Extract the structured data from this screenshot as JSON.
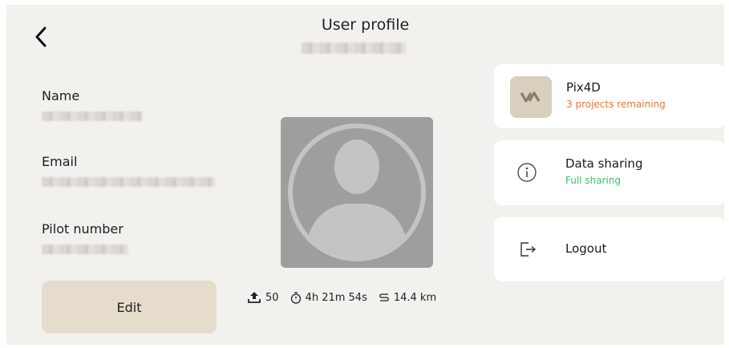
{
  "header": {
    "back_icon": "chevron-left-icon",
    "title": "User profile"
  },
  "profile": {
    "name_label": "Name",
    "email_label": "Email",
    "pilot_number_label": "Pilot number",
    "edit_label": "Edit"
  },
  "stats": {
    "uploads_icon": "upload-icon",
    "uploads": "50",
    "flight_time_icon": "stopwatch-icon",
    "flight_time": "4h 21m 54s",
    "distance_icon": "distance-icon",
    "distance": "14.4 km"
  },
  "cards": {
    "pix4d": {
      "title": "Pix4D",
      "subtitle": "3 projects remaining",
      "subtitle_color": "#e8763e"
    },
    "data_sharing": {
      "title": "Data sharing",
      "subtitle": "Full sharing",
      "subtitle_color": "#3cbf6c"
    },
    "logout": {
      "title": "Logout"
    }
  },
  "colors": {
    "background": "#f3f1ed",
    "edit_button": "#e5dccb",
    "avatar_bg": "#9e9e9e",
    "avatar_fg": "#c4c4c4"
  }
}
